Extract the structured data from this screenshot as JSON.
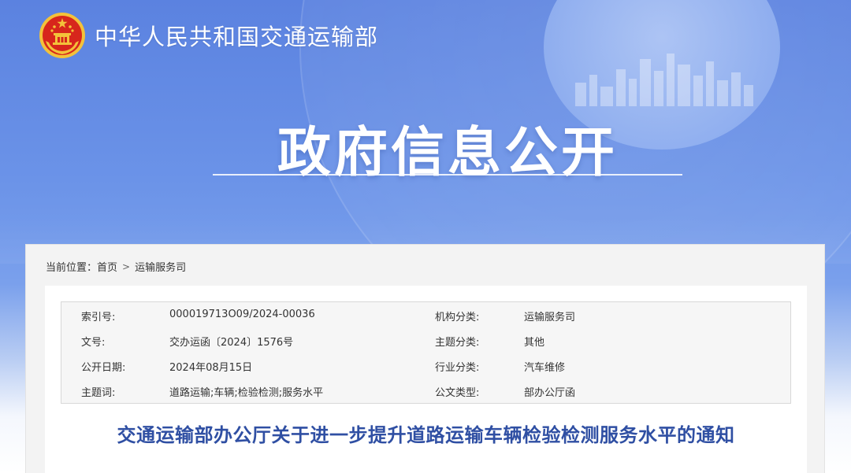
{
  "header": {
    "ministry_name": "中华人民共和国交通运输部",
    "section_title": "政府信息公开"
  },
  "breadcrumb": {
    "prefix": "当前位置：",
    "items": [
      "首页",
      "运输服务司"
    ],
    "separator": ">"
  },
  "meta": {
    "rows": [
      {
        "k1": "索引号:",
        "v1": "000019713O09/2024-00036",
        "k2": "机构分类:",
        "v2": "运输服务司"
      },
      {
        "k1": "文号:",
        "v1": "交办运函〔2024〕1576号",
        "k2": "主题分类:",
        "v2": "其他"
      },
      {
        "k1": "公开日期:",
        "v1": "2024年08月15日",
        "k2": "行业分类:",
        "v2": "汽车维修"
      },
      {
        "k1": "主题词:",
        "v1": "道路运输;车辆;检验检测;服务水平",
        "k2": "公文类型:",
        "v2": "部办公厅函"
      }
    ]
  },
  "document": {
    "title": "交通运输部办公厅关于进一步提升道路运输车辆检验检测服务水平的通知"
  },
  "colors": {
    "banner_blue": "#5b82e0",
    "title_blue": "#2f4fa3",
    "emblem_red": "#d7261c",
    "emblem_gold": "#f3c23a"
  }
}
